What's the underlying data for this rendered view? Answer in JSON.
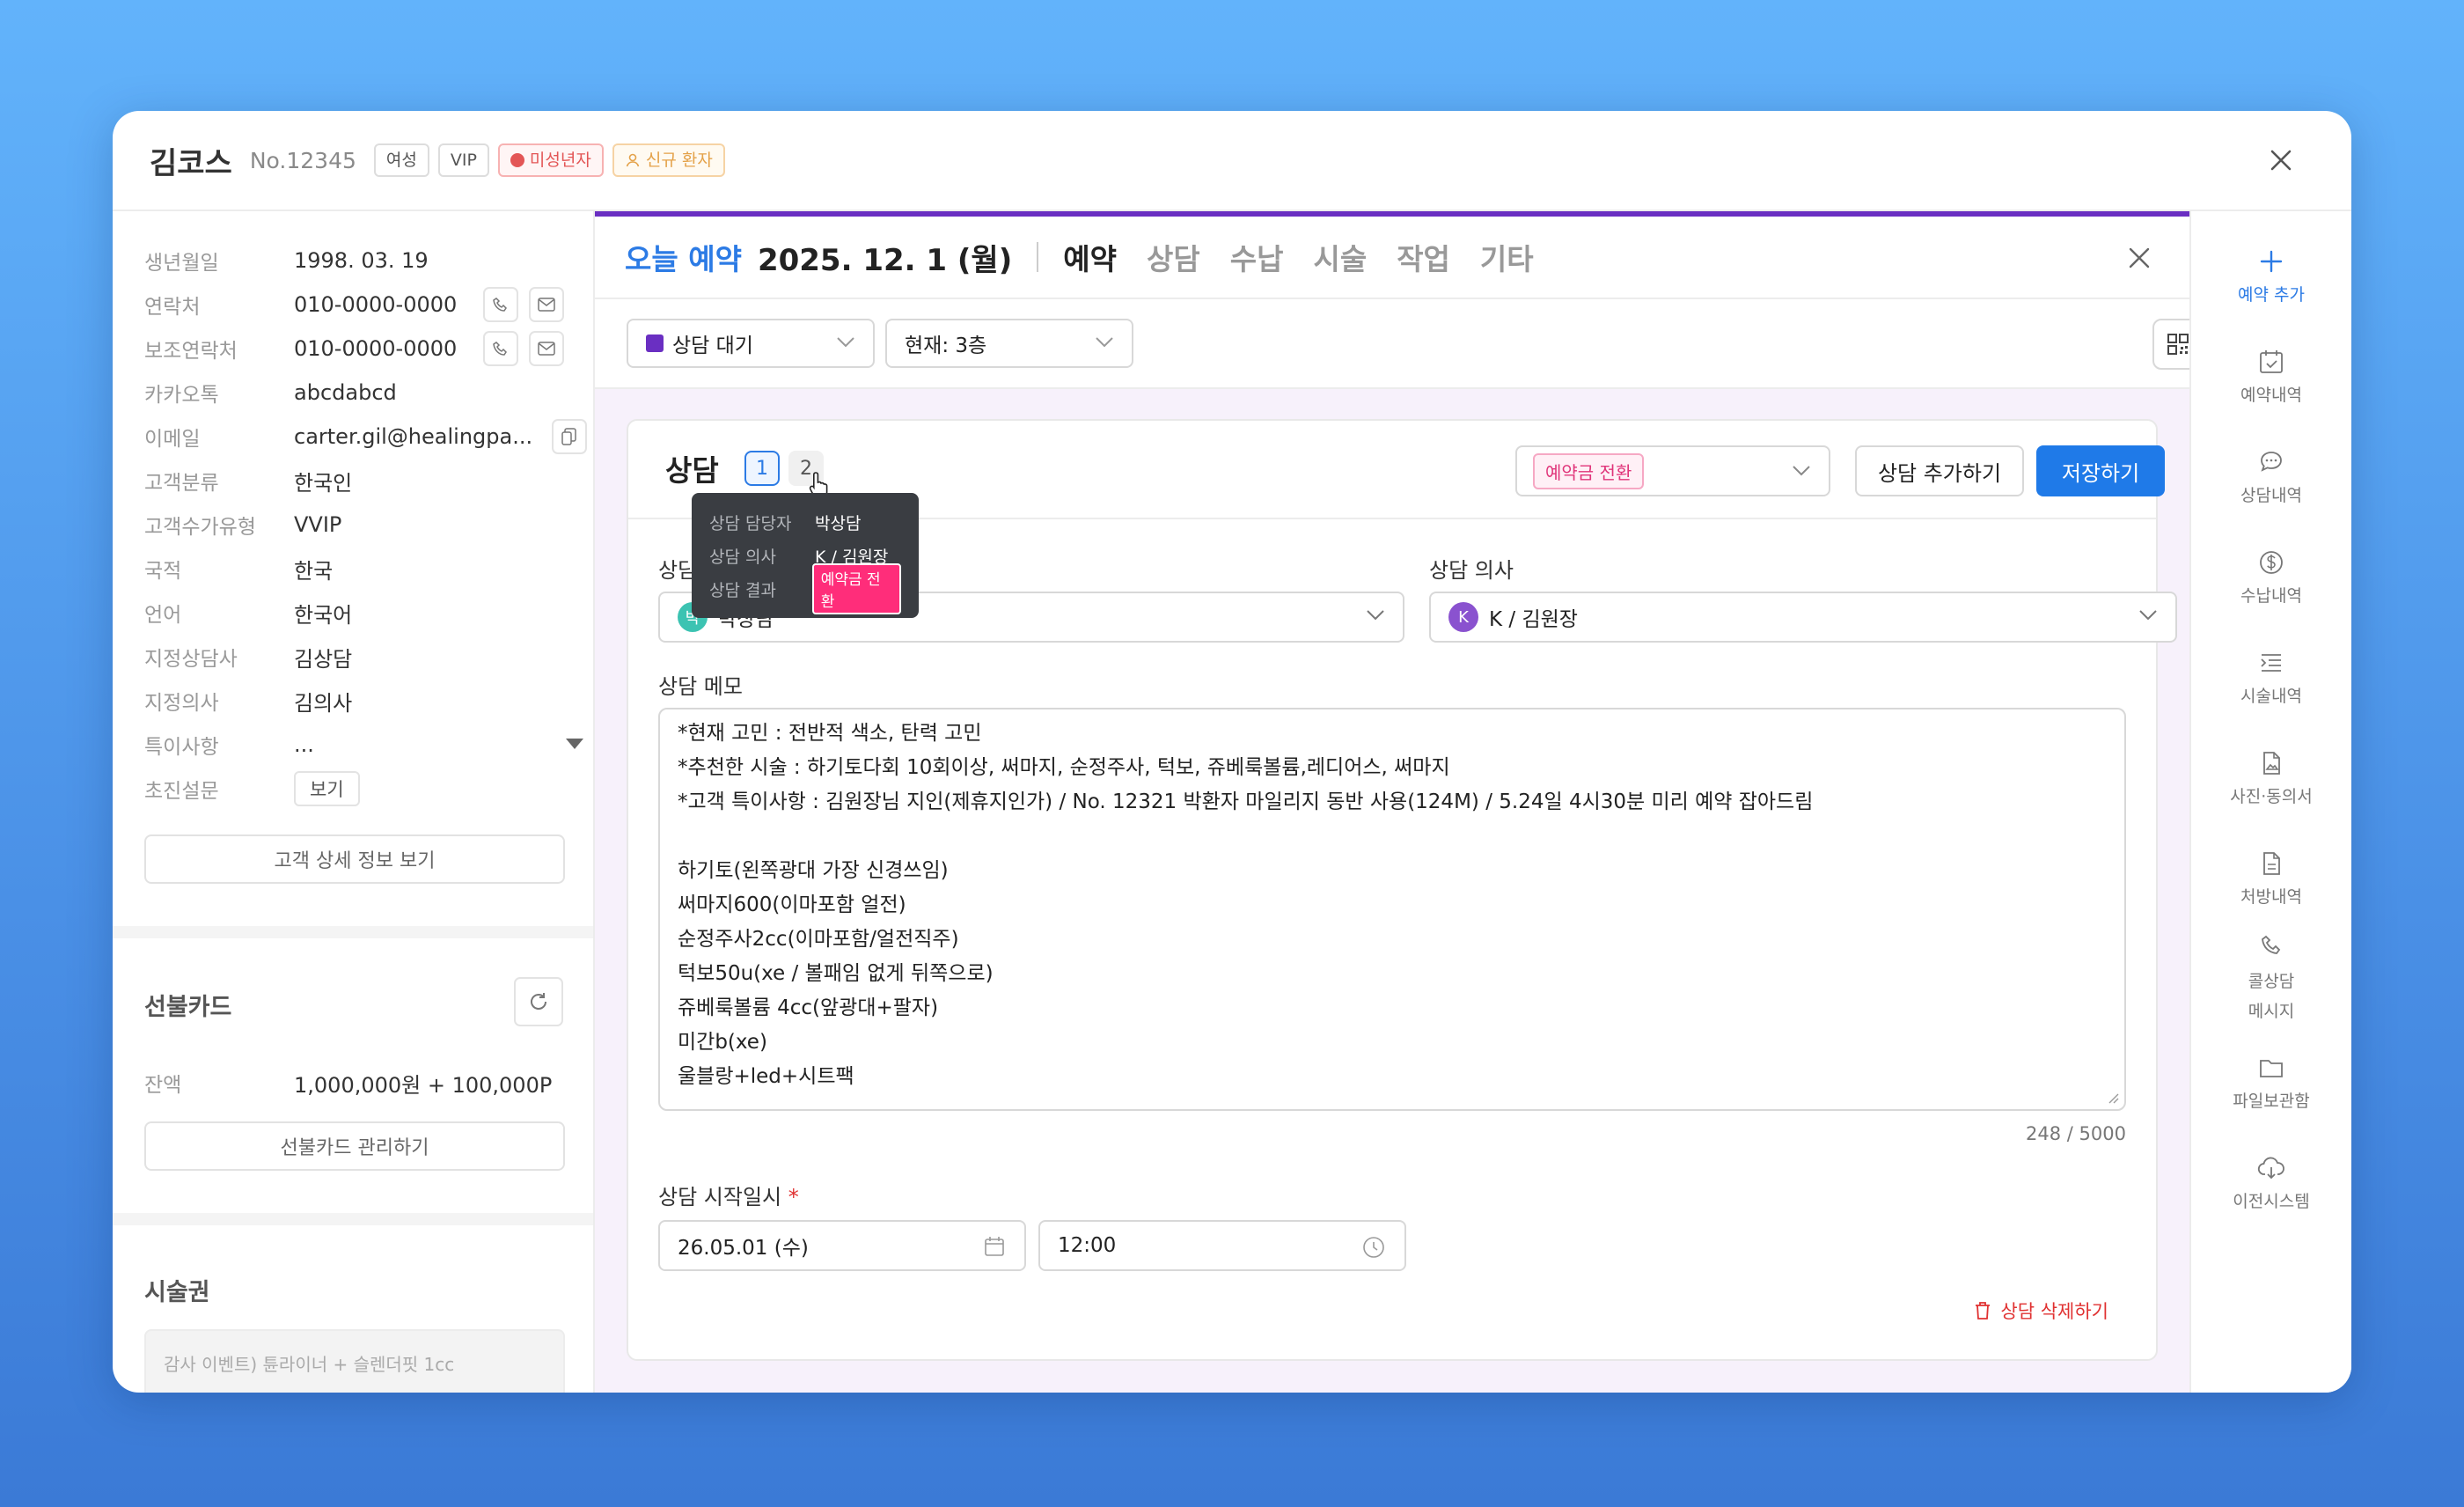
{
  "patient": {
    "name": "김코스",
    "number": "No.12345",
    "badges": [
      "여성",
      "VIP"
    ],
    "minor_badge": "미성년자",
    "new_badge": "신규 환자"
  },
  "info": [
    {
      "label": "생년월일",
      "value": "1998. 03. 19"
    },
    {
      "label": "연락처",
      "value": "010-0000-0000"
    },
    {
      "label": "보조연락처",
      "value": "010-0000-0000"
    },
    {
      "label": "카카오톡",
      "value": "abcdabcd"
    },
    {
      "label": "이메일",
      "value": "carter.gil@healingpa..."
    },
    {
      "label": "고객분류",
      "value": "한국인"
    },
    {
      "label": "고객수가유형",
      "value": "VVIP"
    },
    {
      "label": "국적",
      "value": "한국"
    },
    {
      "label": "언어",
      "value": "한국어"
    },
    {
      "label": "지정상담사",
      "value": "김상담"
    },
    {
      "label": "지정의사",
      "value": "김의사"
    },
    {
      "label": "특이사항",
      "value": "..."
    },
    {
      "label": "초진설문",
      "value": "보기"
    }
  ],
  "left": {
    "detail_button": "고객 상세 정보 보기",
    "prepaid_title": "선불카드",
    "balance_label": "잔액",
    "balance_value": "1,000,000원 + 100,000P",
    "prepaid_manage": "선불카드 관리하기",
    "treatment_title": "시술권",
    "treatment_item": "감사 이벤트) 튠라이너 + 슬렌더핏 1cc"
  },
  "center": {
    "today_label": "오늘 예약",
    "date": "2025. 12. 1 (월)",
    "tabs": [
      "예약",
      "상담",
      "수납",
      "시술",
      "작업",
      "기타"
    ],
    "status_select": "상담 대기",
    "floor_select": "현재: 3층"
  },
  "consult": {
    "title": "상담",
    "tabs": [
      "1",
      "2"
    ],
    "result_tag": "예약금 전환",
    "add_button": "상담 추가하기",
    "save_button": "저장하기",
    "counselor_label": "상담",
    "counselor_initial": "박",
    "counselor_value": "박상담",
    "doctor_label": "상담 의사",
    "doctor_initial": "K",
    "doctor_value": "K / 김원장",
    "memo_label": "상담 메모",
    "memo_lines": [
      "*현재 고민 : 전반적 색소, 탄력 고민",
      "*추천한 시술 : 하기토다회 10회이상, 써마지, 순정주사, 턱보, 쥬베룩볼륨,레디어스, 써마지",
      "*고객 특이사항 : 김원장님 지인(제휴지인가) / No. 12321 박환자 마일리지 동반 사용(124M) / 5.24일 4시30분 미리 예약 잡아드림",
      "",
      "하기토(왼쪽광대 가장 신경쓰임)",
      "써마지600(이마포함 얼전)",
      "순정주사2cc(이마포함/얼전직주)",
      "턱보50u(xe / 볼패임 없게 뒤쪽으로)",
      "쥬베룩볼륨 4cc(앞광대+팔자)",
      "미간b(xe)",
      "울블랑+led+시트팩"
    ],
    "counter": "248 / 5000",
    "start_label": "상담 시작일시",
    "required_mark": "*",
    "date_value": "26.05.01 (수)",
    "time_value": "12:00",
    "delete_button": "상담 삭제하기"
  },
  "tooltip": {
    "rows": [
      {
        "k": "상담 담당자",
        "v": "박상담"
      },
      {
        "k": "상담 의사",
        "v": "K / 김원장"
      },
      {
        "k": "상담 결과",
        "v": "예약금 전환"
      }
    ]
  },
  "rail": [
    "예약 추가",
    "예약내역",
    "상담내역",
    "수납내역",
    "시술내역",
    "사진·동의서",
    "처방내역",
    "콜상담",
    "메시지",
    "파일보관함",
    "이전시스템"
  ],
  "colors": {
    "accent": "#2c7be5",
    "purple": "#6a2fc2",
    "pink": "#e0357a",
    "red": "#e03131"
  }
}
